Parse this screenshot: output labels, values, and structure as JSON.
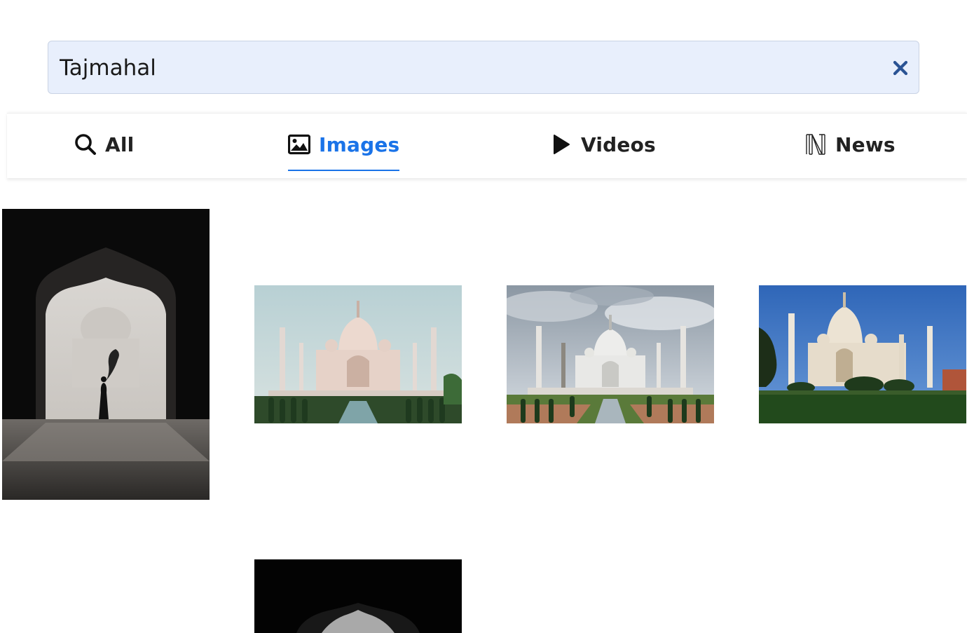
{
  "search": {
    "query": "Tajmahal",
    "clear_icon": "close-icon"
  },
  "tabs": [
    {
      "label": "All",
      "icon": "search-icon",
      "active": false
    },
    {
      "label": "Images",
      "icon": "image-icon",
      "active": true
    },
    {
      "label": "Videos",
      "icon": "play-icon",
      "active": false
    },
    {
      "label": "News",
      "icon": "news-icon",
      "active": false
    }
  ],
  "colors": {
    "accent": "#1a73e8",
    "search_bg": "#e8effc",
    "clear_icon": "#2a5394"
  },
  "results": [
    {
      "kind": "archway-silhouette",
      "tone": "monochrome"
    },
    {
      "kind": "taj-mahal-pink-dawn",
      "tone": "color"
    },
    {
      "kind": "taj-mahal-cloudy",
      "tone": "color"
    },
    {
      "kind": "taj-mahal-blue-sky",
      "tone": "color"
    },
    {
      "kind": "archway-dark",
      "tone": "monochrome"
    }
  ]
}
